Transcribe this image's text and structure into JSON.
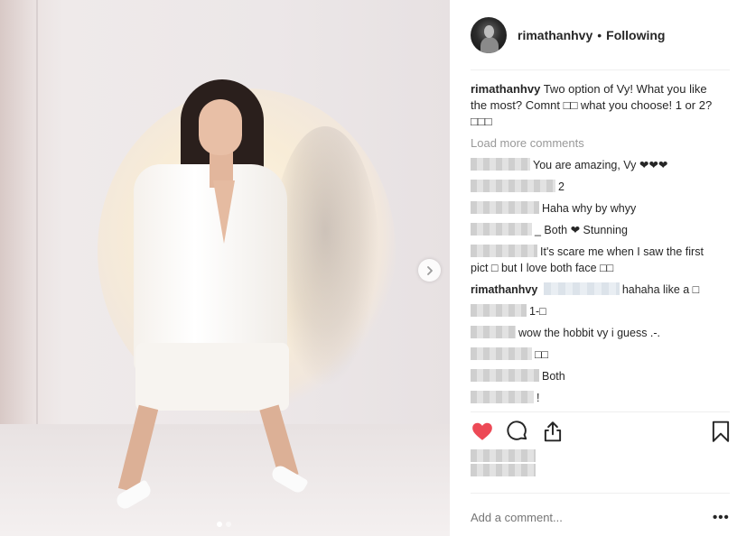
{
  "post": {
    "username": "rimathanhvy",
    "separator": "•",
    "follow_state": "Following",
    "caption": "Two option of Vy! What you like the most? Comnt □□ what you choose! 1 or 2? □□□",
    "load_more": "Load more comments",
    "add_comment_placeholder": "Add a comment...",
    "more_options": "•••"
  },
  "comments": [
    {
      "author": "",
      "text": "You are amazing, Vy ❤❤❤"
    },
    {
      "author": "",
      "text": "2"
    },
    {
      "author": "",
      "text": "Haha why by whyy"
    },
    {
      "author": "",
      "text": "_ Both ❤ Stunning"
    },
    {
      "author": "",
      "text": "It's scare me when I saw the first pict □ but I love both face □□"
    },
    {
      "author": "rimathanhvy",
      "text": "hahaha like a □"
    },
    {
      "author": "",
      "text": "1-□"
    },
    {
      "author": "",
      "text": "wow the hobbit vy i guess .-."
    },
    {
      "author": "",
      "text": "□□"
    },
    {
      "author": "",
      "text": "Both"
    },
    {
      "author": "",
      "text": "!"
    }
  ],
  "carousel": {
    "slides": 2,
    "current": 1
  },
  "icons": {
    "like": "heart-icon",
    "comment": "comment-icon",
    "share": "share-icon",
    "save": "bookmark-icon",
    "next": "chevron-right-icon"
  },
  "colors": {
    "like_active": "#ed4956",
    "text": "#262626",
    "muted": "#999999"
  }
}
